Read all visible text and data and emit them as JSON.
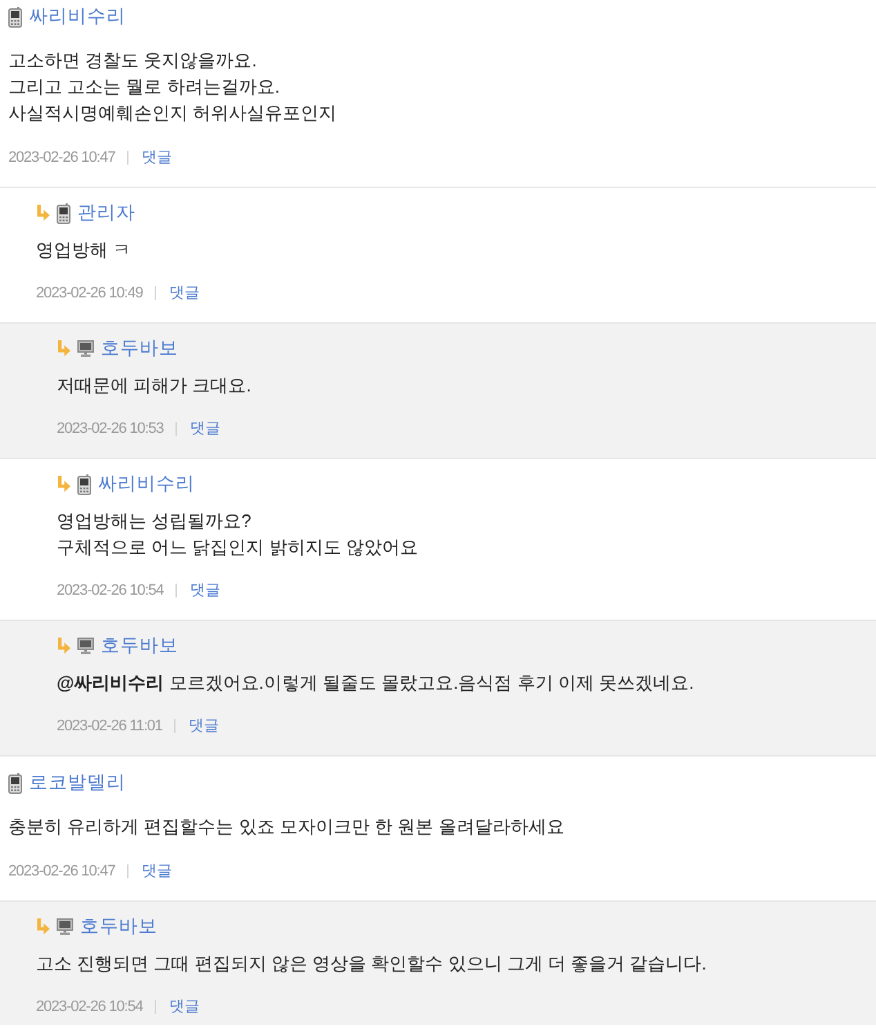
{
  "comments": [
    {
      "author": "싸리비수리",
      "kind": "mobile",
      "highlighted": false,
      "text": "고소하면 경찰도 웃지않을까요.\n그리고 고소는 뭘로 하려는걸까요.\n사실적시명예훼손인지 허위사실유포인지",
      "date": "2023-02-26 10:47",
      "reply_link": "댓글",
      "children": [
        {
          "author": "관리자",
          "kind": "mobile",
          "highlighted": false,
          "text": "영업방해 ㅋ",
          "date": "2023-02-26 10:49",
          "reply_link": "댓글",
          "children": [
            {
              "author": "호두바보",
              "kind": "pc",
              "highlighted": true,
              "text": "저때문에 피해가 크대요.",
              "date": "2023-02-26 10:53",
              "reply_link": "댓글"
            },
            {
              "author": "싸리비수리",
              "kind": "mobile",
              "highlighted": false,
              "text": "영업방해는 성립될까요?\n구체적으로 어느 닭집인지 밝히지도 않았어요",
              "date": "2023-02-26 10:54",
              "reply_link": "댓글"
            },
            {
              "author": "호두바보",
              "kind": "pc",
              "highlighted": true,
              "text": "**@싸리비수리** 모르겠어요.이렇게 될줄도 몰랐고요.음식점 후기 이제 못쓰겠네요.",
              "date": "2023-02-26 11:01",
              "reply_link": "댓글"
            }
          ]
        }
      ]
    },
    {
      "author": "로코발델리",
      "kind": "mobile",
      "highlighted": false,
      "text": "충분히 유리하게 편집할수는 있죠 모자이크만 한 원본 올려달라하세요",
      "date": "2023-02-26 10:47",
      "reply_link": "댓글",
      "children": [
        {
          "author": "호두바보",
          "kind": "pc",
          "highlighted": true,
          "text": "고소 진행되면 그때 편집되지 않은 영상을 확인할수 있으니 그게 더 좋을거 같습니다.",
          "date": "2023-02-26 10:54",
          "reply_link": "댓글"
        }
      ]
    }
  ]
}
